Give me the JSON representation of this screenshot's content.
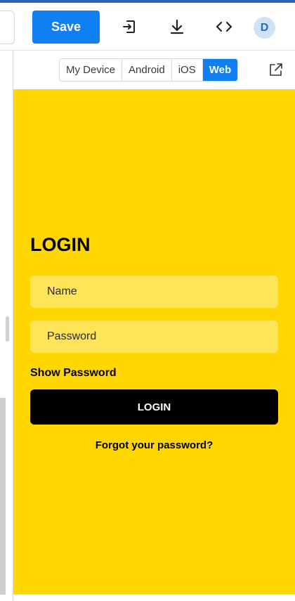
{
  "toolbar": {
    "save_label": "Save",
    "avatar_initial": "D",
    "icons": [
      "import-icon",
      "download-icon",
      "code-icon"
    ]
  },
  "device_tabs": [
    {
      "label": "My Device",
      "active": false
    },
    {
      "label": "Android",
      "active": false
    },
    {
      "label": "iOS",
      "active": false
    },
    {
      "label": "Web",
      "active": true
    }
  ],
  "preview": {
    "title": "LOGIN",
    "name_placeholder": "Name",
    "password_placeholder": "Password",
    "show_password": "Show Password",
    "login_button": "LOGIN",
    "forgot_password": "Forgot your password?"
  },
  "colors": {
    "accent": "#0f7ff2",
    "preview_bg": "#ffd600",
    "field_bg": "#ffe45a",
    "button_bg": "#000000"
  }
}
